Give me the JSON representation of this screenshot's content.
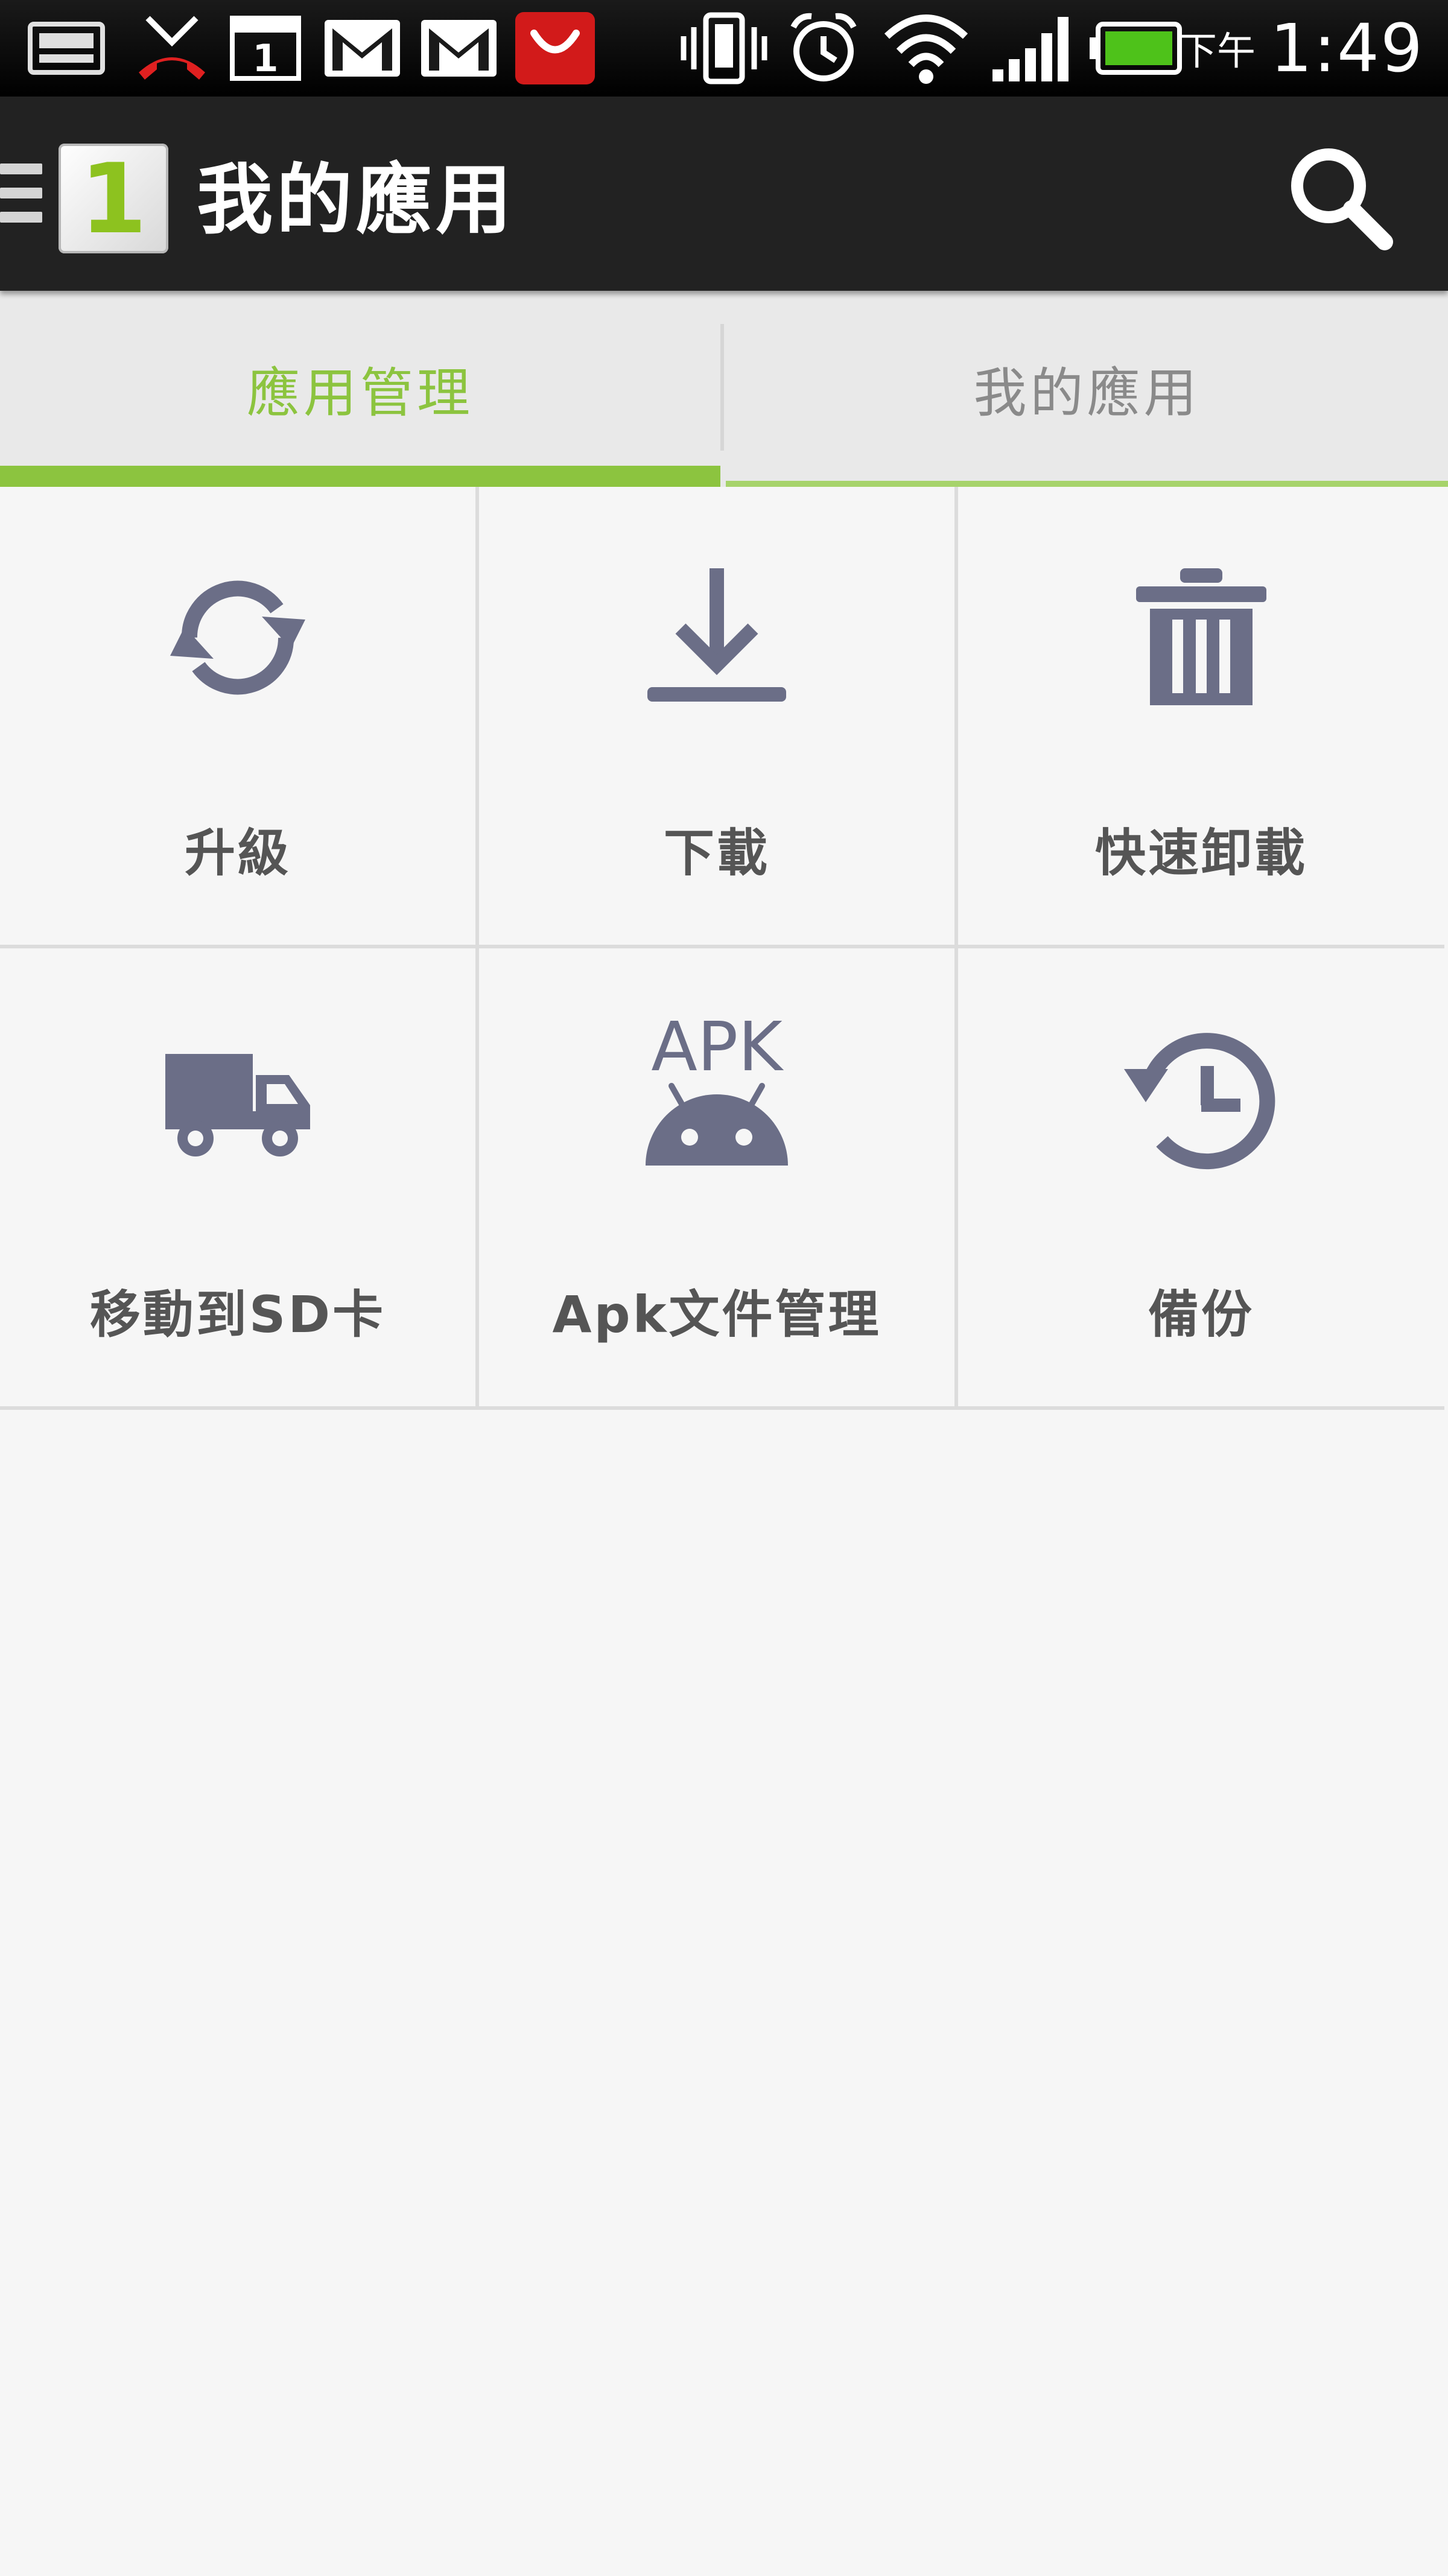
{
  "status_bar": {
    "ampm": "下午",
    "time": "1:49",
    "icons": [
      "keyboard-icon",
      "missed-call-icon",
      "calendar-icon",
      "gmail-icon",
      "gmail-icon",
      "red-app-icon",
      "vibrate-icon",
      "alarm-icon",
      "wifi-icon",
      "signal-icon",
      "battery-icon"
    ],
    "calendar_day": "1"
  },
  "action_bar": {
    "title": "我的應用",
    "logo_digit": "1"
  },
  "tabs": [
    {
      "label": "應用管理",
      "active": true
    },
    {
      "label": "我的應用",
      "active": false
    }
  ],
  "grid": [
    {
      "label": "升級",
      "icon": "refresh-icon"
    },
    {
      "label": "下載",
      "icon": "download-icon"
    },
    {
      "label": "快速卸載",
      "icon": "trash-icon"
    },
    {
      "label": "移動到SD卡",
      "icon": "truck-icon"
    },
    {
      "label": "Apk文件管理",
      "icon": "apk-android-icon",
      "icon_text": "APK"
    },
    {
      "label": "備份",
      "icon": "history-icon"
    }
  ],
  "colors": {
    "accent": "#8cc43f",
    "icon": "#6b6e87",
    "label": "#555555",
    "actionbar": "#222222"
  }
}
